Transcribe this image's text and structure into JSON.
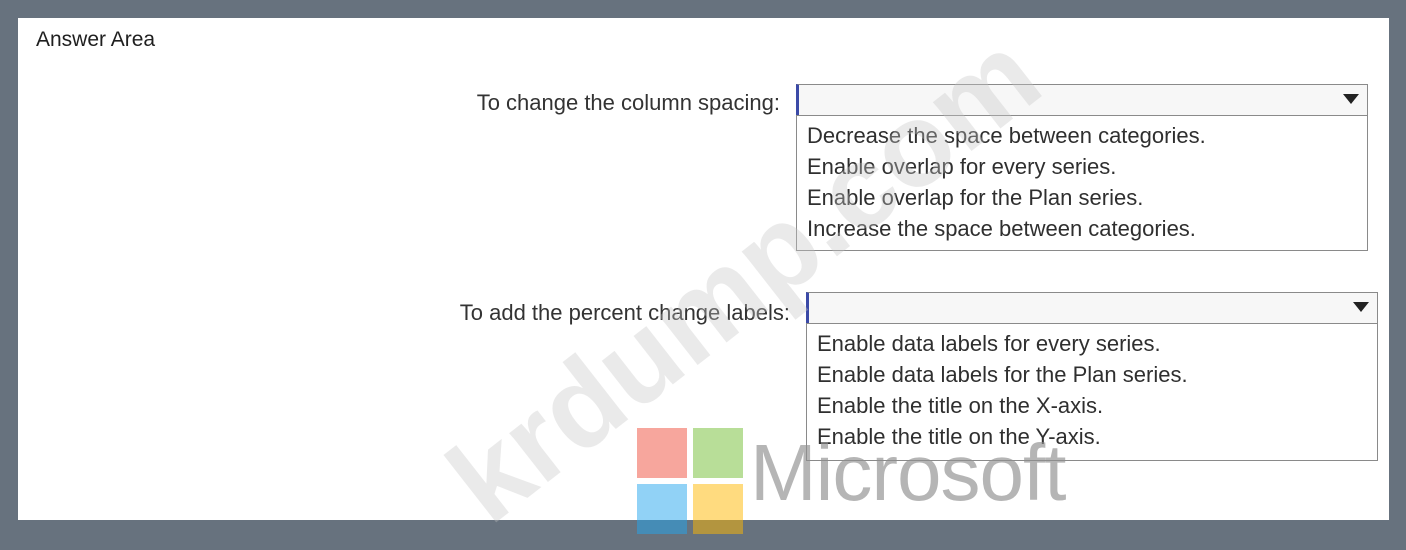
{
  "answer_area": {
    "title": "Answer Area"
  },
  "questions": [
    {
      "label": "To change the column spacing:",
      "selected": "",
      "options": [
        "Decrease the space between categories.",
        "Enable overlap for every series.",
        "Enable overlap for the Plan series.",
        "Increase the space between categories."
      ]
    },
    {
      "label": "To add the percent change labels:",
      "selected": "",
      "options": [
        "Enable data labels for every series.",
        "Enable data labels for the Plan series.",
        "Enable the title on the X-axis.",
        "Enable the title on the Y-axis."
      ]
    }
  ],
  "watermark": {
    "text": "krdump.com"
  },
  "brand": {
    "name": "Microsoft",
    "colors": {
      "red": "#f04d3b",
      "green": "#7ec344",
      "blue": "#23a5ee",
      "yellow": "#ffb700"
    }
  },
  "colors": {
    "frame": "#67727e",
    "panel": "#ffffff",
    "dropdown_accent": "#3b4aa7"
  }
}
